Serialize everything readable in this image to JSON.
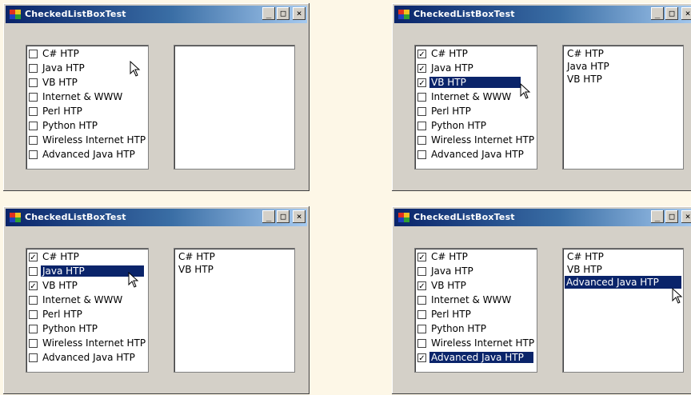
{
  "window_title": "CheckedListBoxTest",
  "titlebar_buttons": {
    "minimize": "_",
    "maximize": "□",
    "close": "×"
  },
  "colors": {
    "titlebar_start": "#0a246a",
    "titlebar_end": "#a6caf0",
    "selection": "#0a246a",
    "window_face": "#d4d0c8"
  },
  "windows": [
    {
      "name": "window-1",
      "items": [
        {
          "label": "C# HTP",
          "checked": false,
          "selected": false
        },
        {
          "label": "Java HTP",
          "checked": false,
          "selected": false
        },
        {
          "label": "VB HTP",
          "checked": false,
          "selected": false
        },
        {
          "label": "Internet & WWW",
          "checked": false,
          "selected": false
        },
        {
          "label": "Perl HTP",
          "checked": false,
          "selected": false
        },
        {
          "label": "Python HTP",
          "checked": false,
          "selected": false
        },
        {
          "label": "Wireless Internet HTP",
          "checked": false,
          "selected": false
        },
        {
          "label": "Advanced Java HTP",
          "checked": false,
          "selected": false
        }
      ],
      "selected_books": []
    },
    {
      "name": "window-2",
      "items": [
        {
          "label": "C# HTP",
          "checked": true,
          "selected": false
        },
        {
          "label": "Java HTP",
          "checked": true,
          "selected": false
        },
        {
          "label": "VB HTP",
          "checked": true,
          "selected": true
        },
        {
          "label": "Internet & WWW",
          "checked": false,
          "selected": false
        },
        {
          "label": "Perl HTP",
          "checked": false,
          "selected": false
        },
        {
          "label": "Python HTP",
          "checked": false,
          "selected": false
        },
        {
          "label": "Wireless Internet HTP",
          "checked": false,
          "selected": false
        },
        {
          "label": "Advanced Java HTP",
          "checked": false,
          "selected": false
        }
      ],
      "selected_books": [
        {
          "label": "C# HTP",
          "selected": false
        },
        {
          "label": "Java HTP",
          "selected": false
        },
        {
          "label": "VB HTP",
          "selected": false
        }
      ]
    },
    {
      "name": "window-3",
      "items": [
        {
          "label": "C# HTP",
          "checked": true,
          "selected": false
        },
        {
          "label": "Java HTP",
          "checked": false,
          "selected": true
        },
        {
          "label": "VB HTP",
          "checked": true,
          "selected": false
        },
        {
          "label": "Internet & WWW",
          "checked": false,
          "selected": false
        },
        {
          "label": "Perl HTP",
          "checked": false,
          "selected": false
        },
        {
          "label": "Python HTP",
          "checked": false,
          "selected": false
        },
        {
          "label": "Wireless Internet HTP",
          "checked": false,
          "selected": false
        },
        {
          "label": "Advanced Java HTP",
          "checked": false,
          "selected": false
        }
      ],
      "selected_books": [
        {
          "label": "C# HTP",
          "selected": false
        },
        {
          "label": "VB HTP",
          "selected": false
        }
      ]
    },
    {
      "name": "window-4",
      "items": [
        {
          "label": "C# HTP",
          "checked": true,
          "selected": false
        },
        {
          "label": "Java HTP",
          "checked": false,
          "selected": false
        },
        {
          "label": "VB HTP",
          "checked": true,
          "selected": false
        },
        {
          "label": "Internet & WWW",
          "checked": false,
          "selected": false
        },
        {
          "label": "Perl HTP",
          "checked": false,
          "selected": false
        },
        {
          "label": "Python HTP",
          "checked": false,
          "selected": false
        },
        {
          "label": "Wireless Internet HTP",
          "checked": false,
          "selected": false
        },
        {
          "label": "Advanced Java HTP",
          "checked": true,
          "selected": true
        }
      ],
      "selected_books": [
        {
          "label": "C# HTP",
          "selected": false
        },
        {
          "label": "VB HTP",
          "selected": false
        },
        {
          "label": "Advanced Java HTP",
          "selected": true
        }
      ]
    }
  ]
}
